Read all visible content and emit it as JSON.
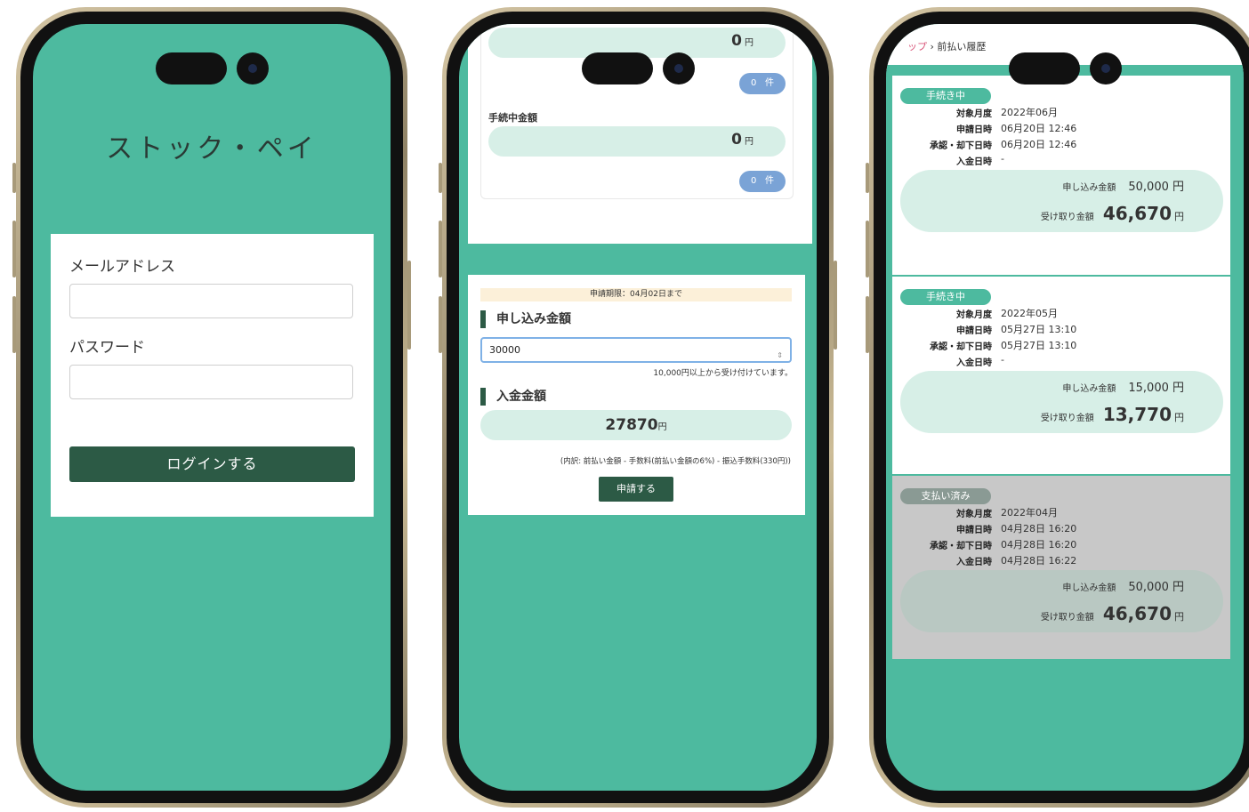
{
  "login": {
    "app_title": "ストック・ペイ",
    "email_label": "メールアドレス",
    "password_label": "パスワード",
    "login_button": "ログインする"
  },
  "dashboard": {
    "top_amount": "0",
    "top_count": "0",
    "pending_label": "手続中金額",
    "pending_amount": "0",
    "pending_count": "0",
    "yen": "円",
    "count_unit": "件"
  },
  "apply": {
    "deadline": "申請期限：04月02日まで",
    "amount_heading": "申し込み金額",
    "amount_value": "30000",
    "hint": "10,000円以上から受け付けています。",
    "deposit_heading": "入金金額",
    "deposit_value": "27870",
    "deposit_unit": "円",
    "breakdown": "(内訳: 前払い金額 - 手数料(前払い金額の6%) - 振込手数料(330円))",
    "submit_button": "申請する"
  },
  "history": {
    "breadcrumb_home": "ップ",
    "breadcrumb_sep": "›",
    "breadcrumb_current": "前払い履歴",
    "labels": {
      "target_month": "対象月度",
      "applied_at": "申請日時",
      "decided_at": "承認・却下日時",
      "deposited_at": "入金日時",
      "applied_amount": "申し込み金額",
      "received_amount": "受け取り金額"
    },
    "items": [
      {
        "status": "手続き中",
        "target_month": "2022年06月",
        "applied_at": "06月20日 12:46",
        "decided_at": "06月20日 12:46",
        "deposited_at": "-",
        "applied_amount": "50,000 円",
        "received_amount": "46,670",
        "yen": "円"
      },
      {
        "status": "手続き中",
        "target_month": "2022年05月",
        "applied_at": "05月27日 13:10",
        "decided_at": "05月27日 13:10",
        "deposited_at": "-",
        "applied_amount": "15,000 円",
        "received_amount": "13,770",
        "yen": "円"
      },
      {
        "status": "支払い済み",
        "target_month": "2022年04月",
        "applied_at": "04月28日 16:20",
        "decided_at": "04月28日 16:20",
        "deposited_at": "04月28日 16:22",
        "applied_amount": "50,000 円",
        "received_amount": "46,670",
        "yen": "円"
      }
    ]
  }
}
